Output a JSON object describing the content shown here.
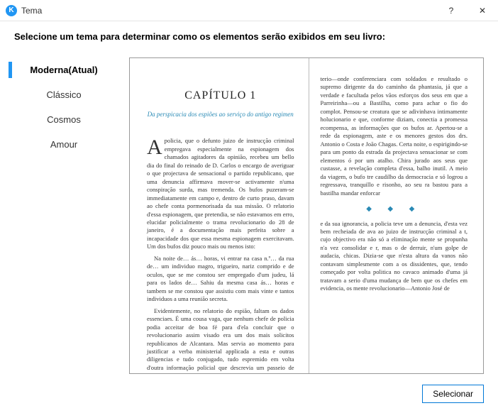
{
  "window": {
    "app_icon_letter": "K",
    "title": "Tema",
    "help_glyph": "?",
    "close_glyph": "✕"
  },
  "instruction": "Selecione um tema para determinar como os elementos serão exibidos em seu livro:",
  "sidebar": {
    "items": [
      {
        "label": "Moderna(Atual)",
        "selected": true
      },
      {
        "label": "Clássico",
        "selected": false
      },
      {
        "label": "Cosmos",
        "selected": false
      },
      {
        "label": "Amour",
        "selected": false
      }
    ]
  },
  "preview": {
    "chapter_title": "CAPÍTULO 1",
    "chapter_subtitle": "Da perspicacia dos espiões ao serviço do antigo regimen",
    "left_paragraphs": [
      "policia, que o defunto juizo de instrucção criminal empregava especialmente na espionagem dos chamados agitadores da opinião, recebeu um bello dia do final do reinado de D. Carlos o encargo de averiguar o que projectava de sensacional o partido republicano, que uma denuncia affirmava mover-se activamente n'uma conspiração surda, mas tremenda. Os bufos puzeram-se immediatamente em campo e, dentro de curto praso, davam ao chefe conta pormenorisada da sua missão. O relatorio d'essa espionagem, que pretendia, se não estavamos em erro, elucidar policialmente o trama revolucionario do 28 de janeiro, é a documentação mais perfeita sobre a incapacidade dos que essa mesma espionagem exercitavam. Um dos bufos diz pouco mais ou menos isto:",
      "Na noite de… ás… horas, vi entrar na casa n.º… da rua de… um individuo magro, trigueiro, nariz comprido e de oculos, que se me constou ser empregado d'um judeu, lá para os lados de… Sahiu da mesma casa ás… horas e tambem se me constou que assistiu com mais vinte e tantos individuos a uma reunião secreta.",
      "Evidentemente, no relatorio do espião, faltam os dados essenciaes. É uma cousa vaga, que nenhum chefe de policia podia acceitar de boa fé para d'ela concluir que o revolucionario assim visado era um dos mais solicitos republicanos de Alcantara. Mas servia ao momento para justificar a verba ministerial applicada a esta e outras diligencias e tudo conjugado, tudo espremido em volta d'outra informação policial que descrevia um passeio de propaganda nocturna dado pelo sr. dr. Antonio José de Almeida às"
    ],
    "dropcap": "A",
    "right_top": "terio—onde conferenciara com soldados e resultado o supremo dirigente da do caminho da phantasia, já que a verdade e facultada pelos vãos esforços dos seus em que a Parreirinha—ou a Bastilha, como para achar o fio do complot. Pensou-se creatura que se adivinhava intimamente holucionario e que, conforme diziam, conectia a promessa ecompensa, as informações que os bufos ar. Apertou-se a rede da espionagem, aste e os menores gestos dos drs. Antonio o Costa e João Chagas. Certa noite, o espirigindo-se para um ponto da estrada da projectava sensacionar se com elementos ó por um atalho. Chira jurado aos seus que custasse, a revelação completa d'essa, balho inutil. A meio da viagem, o bufo tre caudilho da democracia e só logrou a regressava, tranquillo e risonho, ao seu ra bastou para a bastilha mandar enforcar",
    "separator_dots": "◆   ◆   ◆",
    "right_bottom": "e da sua ignorancia, a policia teve um a denuncia, d'esta vez bem recheiada de ava ao juizo de instrucção criminal a t, cujo objectivo era não só a eliminação mente se propunha n'a vez consolidar e r, mas o de derruir, n'um golpe de audacia, chicas. Dizia-se que n'esta altura da vanos não contavam simplesmente com a os dissidentes, que, tendo começado por volta politica no cavaco animado d'uma já tratavam a serio d'uma mudança de bem que os chefes em evidencia, os mente revolucionario—Antonio José de"
  },
  "footer": {
    "select_label": "Selecionar"
  }
}
